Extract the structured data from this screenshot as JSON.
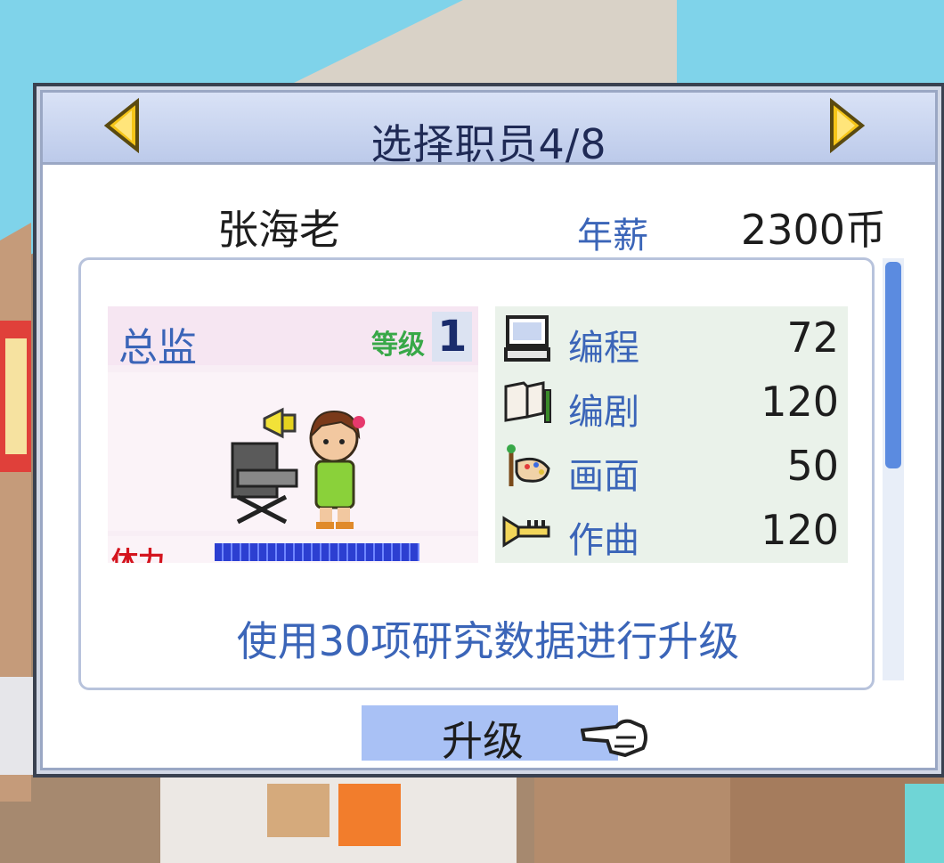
{
  "dialog": {
    "title": "选择职员4/8",
    "staff_name": "张海老",
    "salary_label": "年薪",
    "salary_value": "2300币"
  },
  "role": {
    "title": "总监",
    "level_label": "等级",
    "level_value": "1",
    "stamina_label": "体力",
    "stamina_fraction": 1.0
  },
  "stats": [
    {
      "icon": "computer-icon",
      "name": "编程",
      "value": "72"
    },
    {
      "icon": "book-pencil-icon",
      "name": "编剧",
      "value": "120"
    },
    {
      "icon": "paint-palette-icon",
      "name": "画面",
      "value": "50"
    },
    {
      "icon": "trumpet-icon",
      "name": "作曲",
      "value": "120"
    }
  ],
  "upgrade_note": "使用30项研究数据进行升级",
  "upgrade_button": {
    "label": "升级"
  },
  "colors": {
    "accent_blue": "#3b65b8",
    "title_text": "#1f2a55",
    "button_blue": "#a9c1f5",
    "level_green": "#38a848",
    "stamina_red": "#d4141e"
  }
}
